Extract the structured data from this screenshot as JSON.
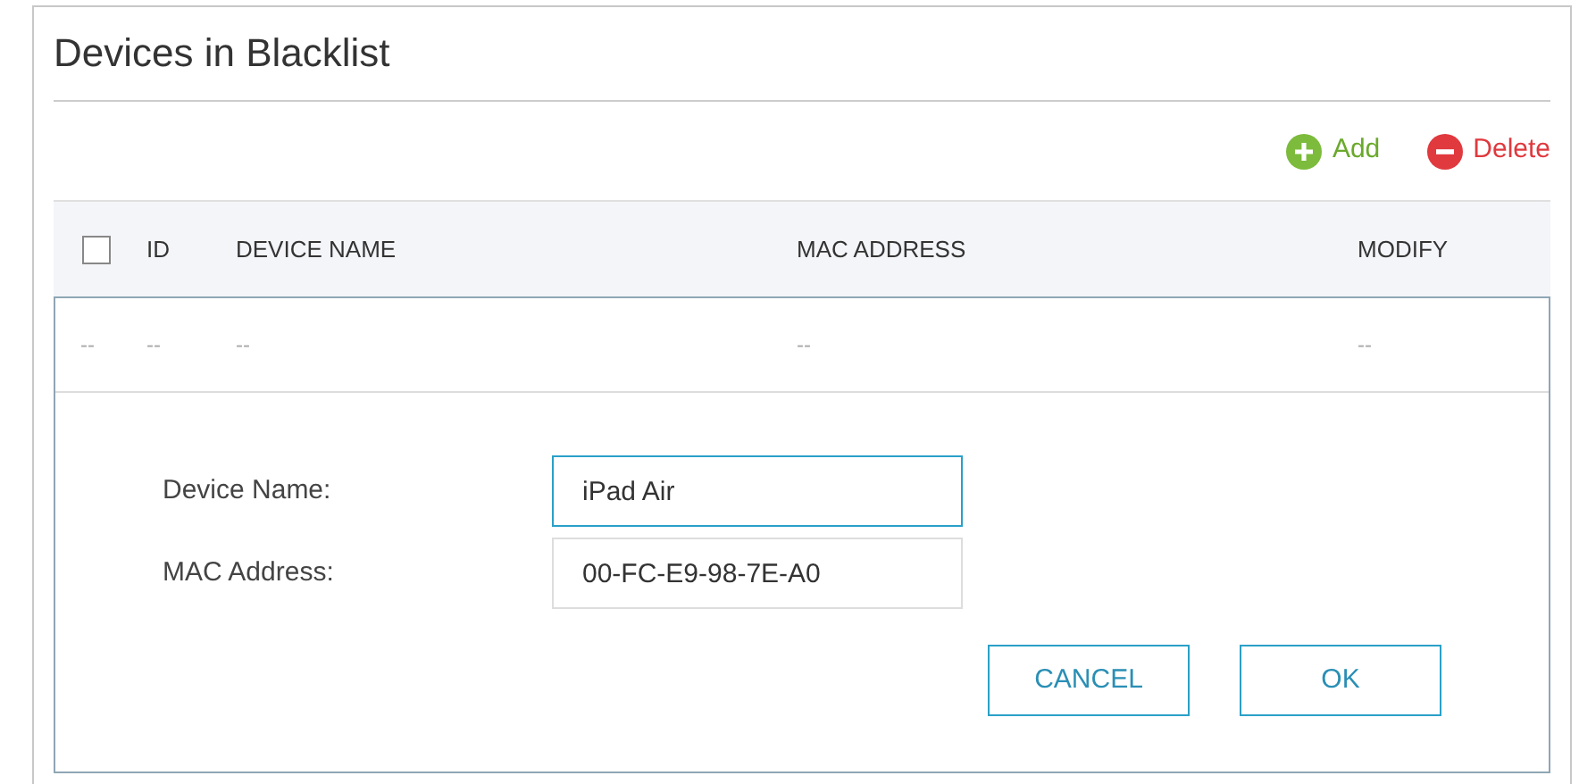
{
  "title": "Devices in Blacklist",
  "actions": [
    {
      "kind": "add",
      "label": "Add"
    },
    {
      "kind": "delete",
      "label": "Delete"
    }
  ],
  "table": {
    "columns": [
      {
        "kind": "checkbox",
        "checked": false
      },
      {
        "kind": "text",
        "label": "ID"
      },
      {
        "kind": "text",
        "label": "DEVICE NAME"
      },
      {
        "kind": "text",
        "label": "MAC ADDRESS"
      },
      {
        "kind": "text",
        "label": "MODIFY"
      }
    ],
    "rows": [
      {
        "cells": [
          "--",
          "--",
          "--",
          "--",
          "--"
        ]
      }
    ]
  },
  "form": {
    "fields": [
      {
        "label": "Device Name:",
        "value": "iPad Air",
        "focused": true
      },
      {
        "label": "MAC Address:",
        "value": "00-FC-E9-98-7E-A0",
        "focused": false
      }
    ],
    "buttons": [
      "CANCEL",
      "OK"
    ]
  }
}
